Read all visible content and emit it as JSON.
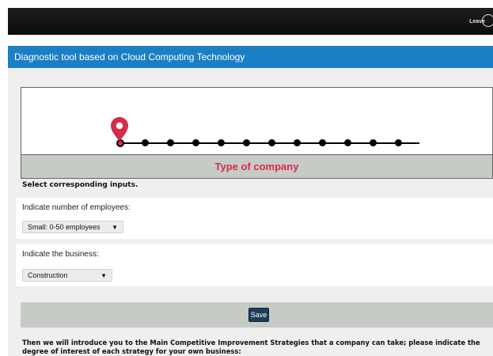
{
  "header": {
    "leave_label": "Leave"
  },
  "title_bar": {
    "title": "Diagnostic tool based on Cloud Computing Technology"
  },
  "stepper": {
    "current_step_label": "Type of company",
    "total_steps": 12,
    "current_step": 1,
    "accent_color": "#d42c4a"
  },
  "form": {
    "section_heading": "Select corresponding inputs.",
    "employees": {
      "label": "Indicate number of employees:",
      "selected": "Small: 0-50 employees"
    },
    "business": {
      "label": "Indicate the business:",
      "selected": "Construction"
    },
    "save_label": "Save"
  },
  "intro": {
    "text": "Then we will introduce you to the Main Competitive Improvement Strategies that a company can take; please indicate the degree of interest of each strategy for your own business:"
  },
  "colors": {
    "title_bar": "#1a7fc4",
    "step_bar": "#c7cbc6",
    "save_button": "#1d3f5b"
  }
}
